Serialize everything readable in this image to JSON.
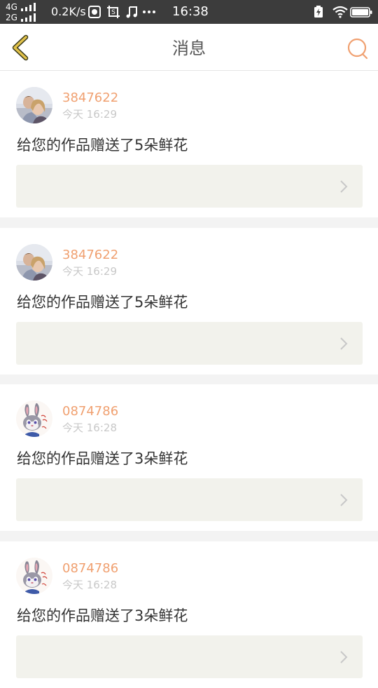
{
  "status_bar": {
    "net_top": "4G",
    "net_bottom": "2G",
    "speed": "0.2K/s",
    "time": "16:38"
  },
  "header": {
    "title": "消息",
    "back_icon": "chevron-left-icon",
    "search_icon": "search-icon"
  },
  "colors": {
    "accent": "#f0a070",
    "back_icon": "#e2c24a",
    "work_box_bg": "#f2f2ec",
    "status_bar_bg": "#3c3c3c"
  },
  "messages": [
    {
      "username": "3847622",
      "time": "今天 16:29",
      "text": "给您的作品赠送了5朵鲜花",
      "avatar": "couple-photo"
    },
    {
      "username": "3847622",
      "time": "今天 16:29",
      "text": "给您的作品赠送了5朵鲜花",
      "avatar": "couple-photo"
    },
    {
      "username": "0874786",
      "time": "今天 16:28",
      "text": "给您的作品赠送了3朵鲜花",
      "avatar": "judy-hopps-rabbit"
    },
    {
      "username": "0874786",
      "time": "今天 16:28",
      "text": "给您的作品赠送了3朵鲜花",
      "avatar": "judy-hopps-rabbit"
    }
  ]
}
